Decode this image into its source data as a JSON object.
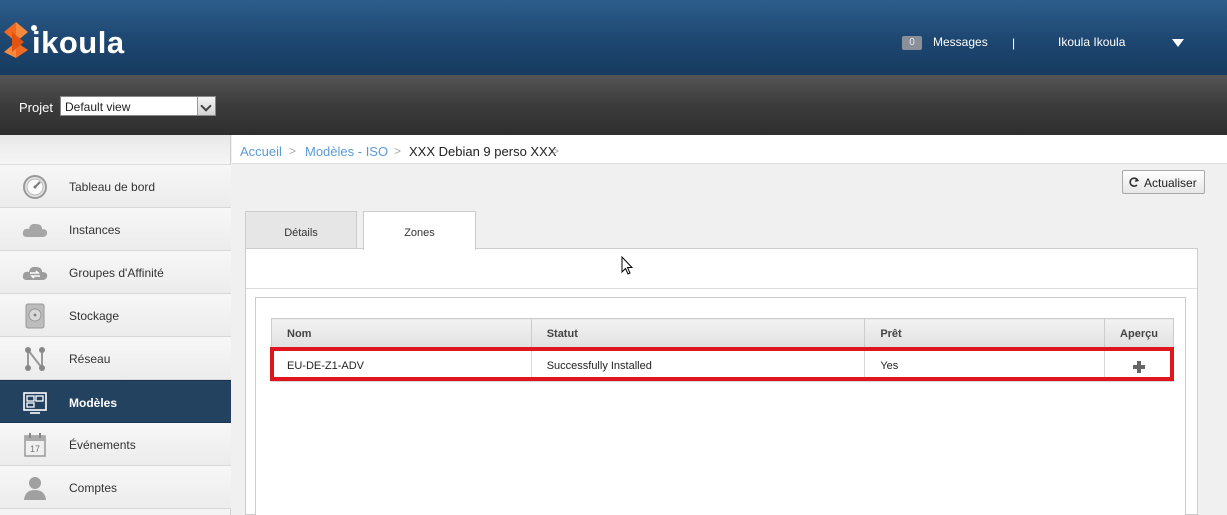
{
  "header": {
    "logo_text": "ikoula",
    "messages_count": "0",
    "messages_label": "Messages",
    "separator": "|",
    "user_name": "Ikoula Ikoula"
  },
  "project": {
    "label": "Projet",
    "selected": "Default view"
  },
  "sidebar": {
    "items": [
      {
        "label": "Tableau de bord",
        "icon": "dashboard-gauge-icon"
      },
      {
        "label": "Instances",
        "icon": "cloud-icon"
      },
      {
        "label": "Groupes d'Affinité",
        "icon": "affinity-cloud-icon"
      },
      {
        "label": "Stockage",
        "icon": "disk-icon"
      },
      {
        "label": "Réseau",
        "icon": "network-icon"
      },
      {
        "label": "Modèles",
        "icon": "templates-icon",
        "active": true
      },
      {
        "label": "Événements",
        "icon": "calendar-icon"
      },
      {
        "label": "Comptes",
        "icon": "user-icon"
      }
    ]
  },
  "breadcrumb": {
    "items": [
      "Accueil",
      "Modèles - ISO",
      "XXX Debian 9 perso XXX"
    ],
    "separator": ">"
  },
  "toolbar": {
    "refresh_label": "Actualiser"
  },
  "tabs": [
    {
      "label": "Détails",
      "active": false
    },
    {
      "label": "Zones",
      "active": true
    }
  ],
  "table": {
    "columns": [
      "Nom",
      "Statut",
      "Prêt",
      "Aperçu"
    ],
    "rows": [
      {
        "name": "EU-DE-Z1-ADV",
        "status": "Successfully Installed",
        "ready": "Yes",
        "preview_icon": "plus-icon"
      }
    ]
  },
  "colors": {
    "header_blue": "#1d4670",
    "sidebar_active": "#23425f",
    "highlight_red": "#e0161f",
    "link_blue": "#5b9bd5",
    "logo_orange": "#f26a21"
  }
}
